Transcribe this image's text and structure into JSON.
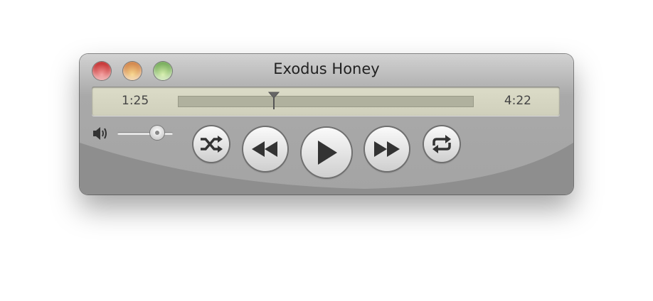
{
  "window": {
    "title": "Exodus Honey"
  },
  "playback": {
    "elapsed": "1:25",
    "remaining": "4:22",
    "progress": 0.325
  },
  "volume": {
    "level": 0.72
  },
  "controls": {
    "shuffle": "shuffle-icon",
    "previous": "rewind-icon",
    "play": "play-icon",
    "next": "fast-forward-icon",
    "repeat": "repeat-icon"
  },
  "colors": {
    "close": "#d04040",
    "minimize": "#e0a060",
    "zoom": "#8cc070"
  }
}
